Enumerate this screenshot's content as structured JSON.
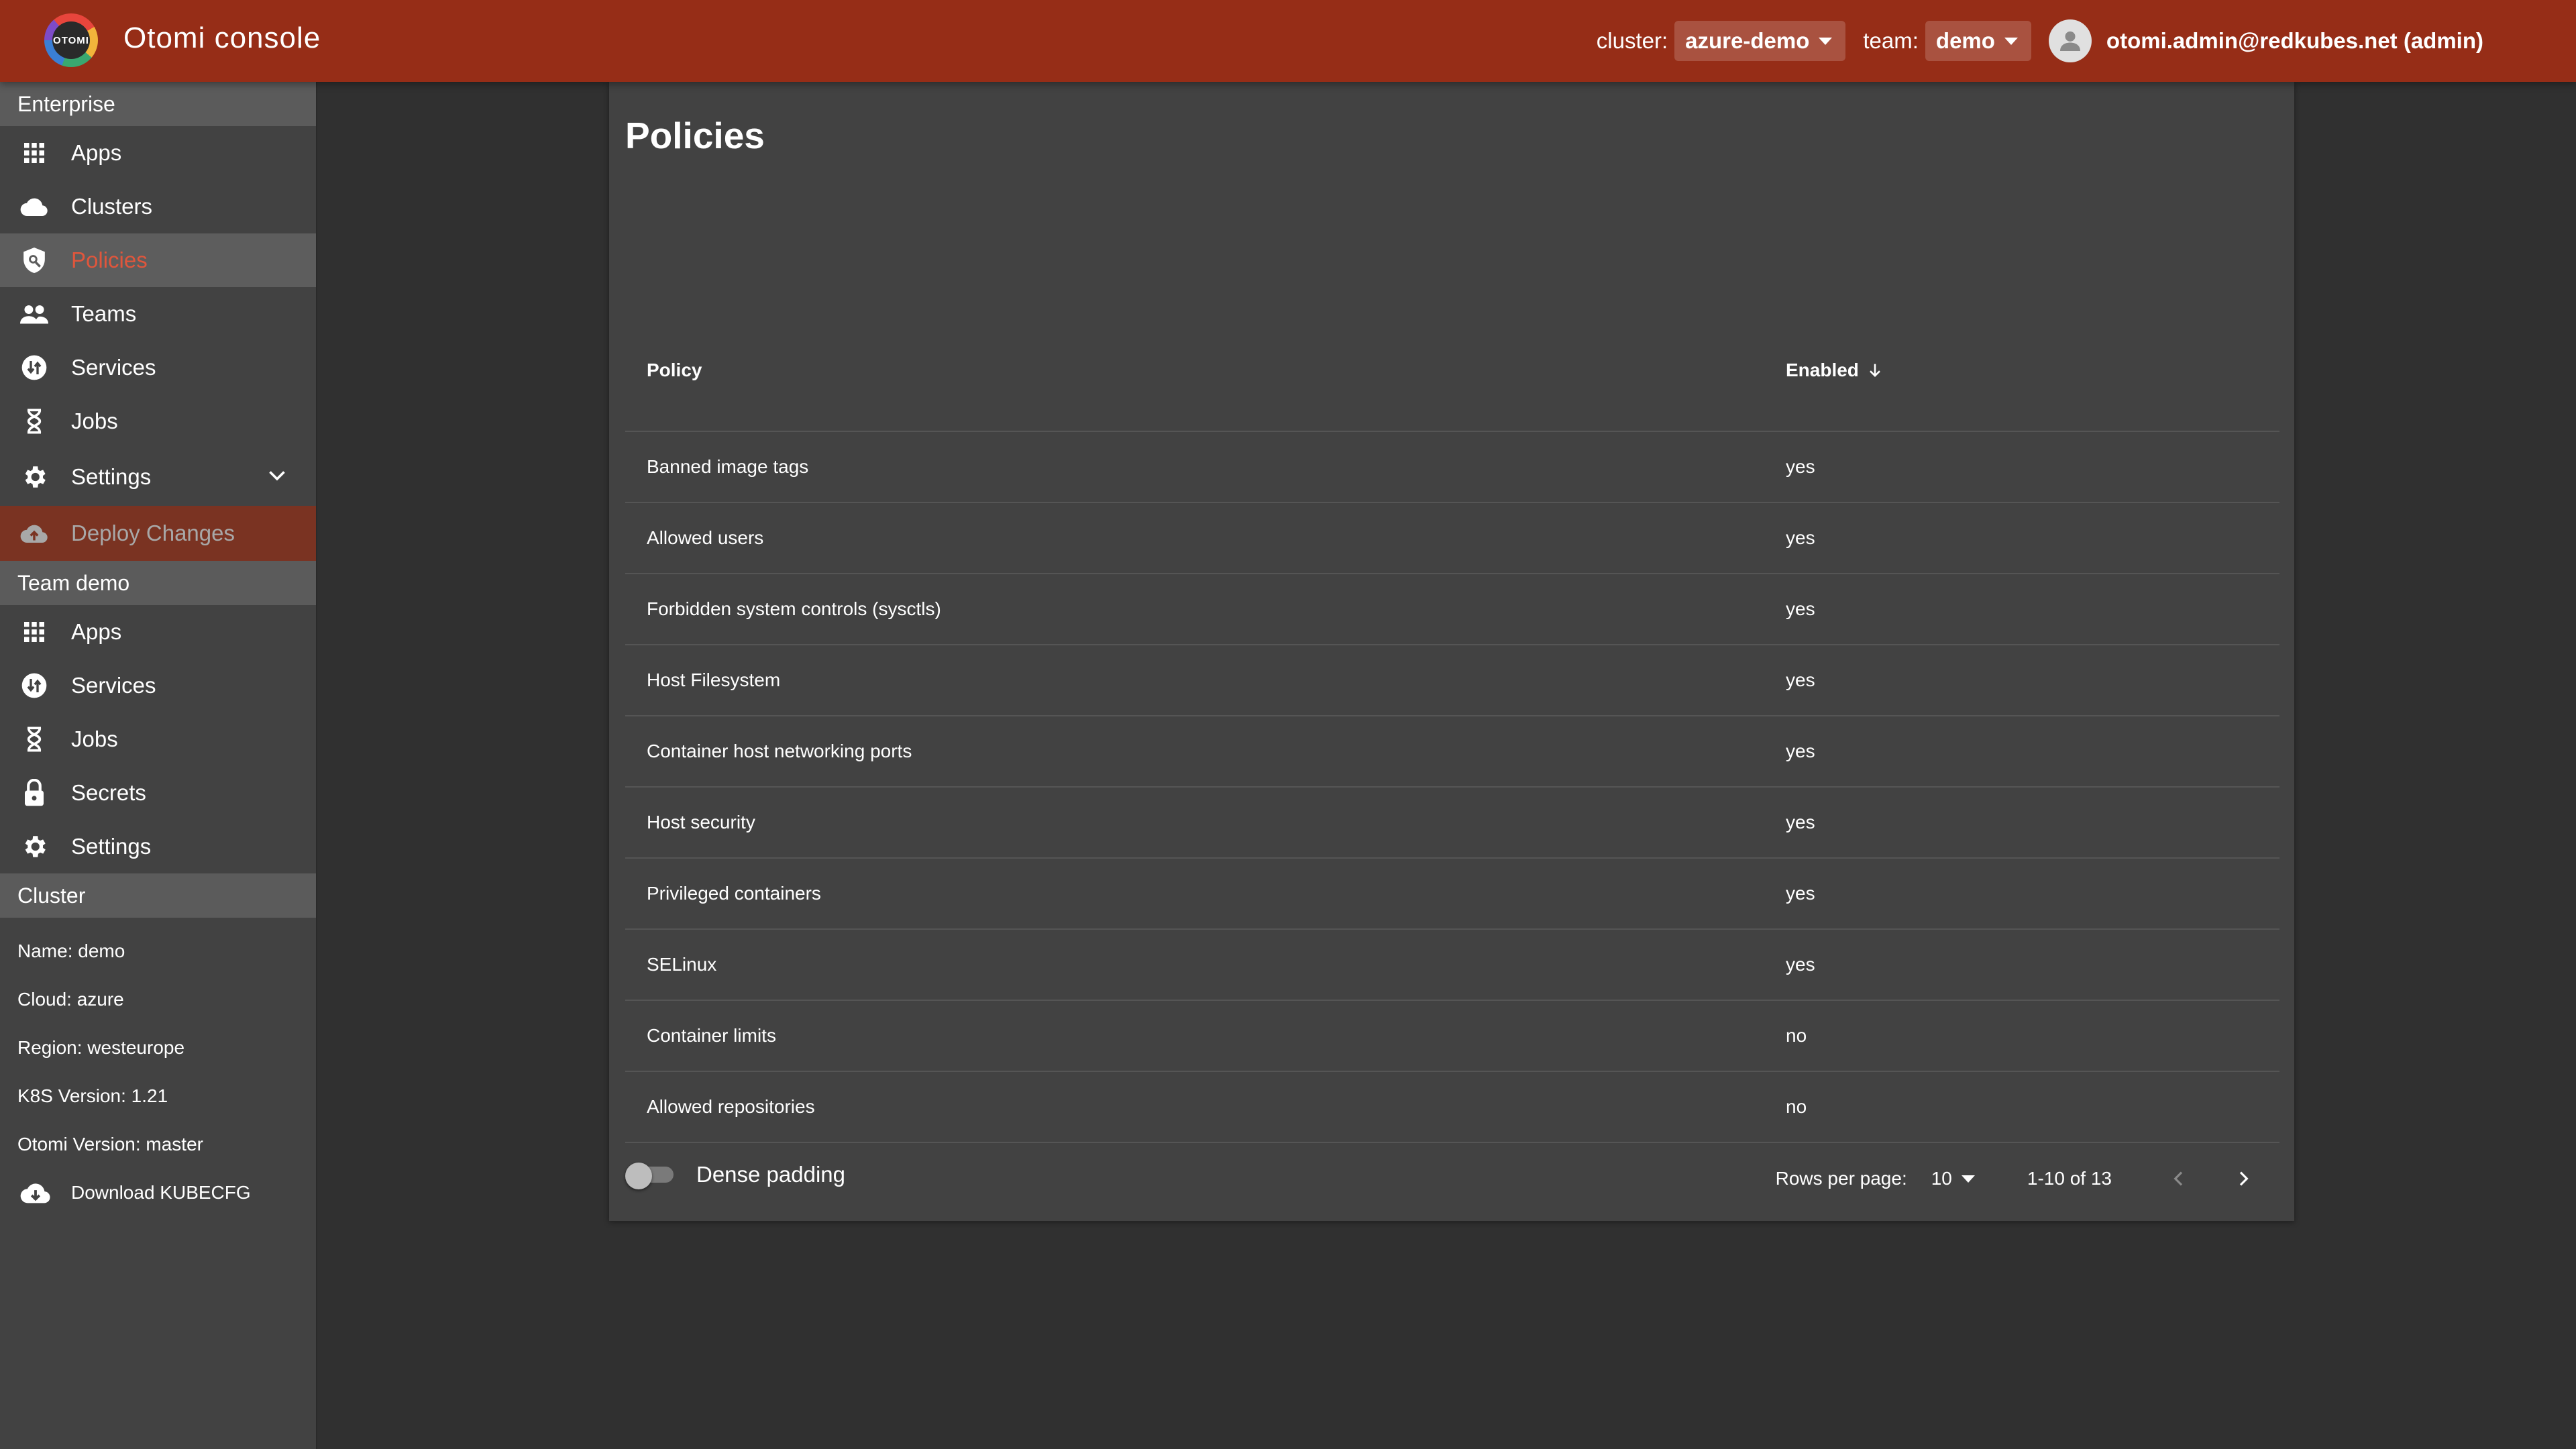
{
  "header": {
    "logo_text": "OTOMI",
    "title": "Otomi console",
    "cluster_label": "cluster:",
    "cluster_value": "azure-demo",
    "team_label": "team:",
    "team_value": "demo",
    "user": "otomi.admin@redkubes.net (admin)"
  },
  "sidebar": {
    "enterprise_header": "Enterprise",
    "enterprise_items": [
      {
        "label": "Apps",
        "icon": "apps-icon"
      },
      {
        "label": "Clusters",
        "icon": "cloud-icon"
      },
      {
        "label": "Policies",
        "icon": "policy-icon",
        "active": true
      },
      {
        "label": "Teams",
        "icon": "people-icon"
      },
      {
        "label": "Services",
        "icon": "swap-icon"
      },
      {
        "label": "Jobs",
        "icon": "hourglass-icon"
      },
      {
        "label": "Settings",
        "icon": "gear-icon"
      }
    ],
    "deploy_label": "Deploy Changes",
    "team_header": "Team demo",
    "team_items": [
      {
        "label": "Apps",
        "icon": "apps-icon"
      },
      {
        "label": "Services",
        "icon": "swap-icon"
      },
      {
        "label": "Jobs",
        "icon": "hourglass-icon"
      },
      {
        "label": "Secrets",
        "icon": "lock-icon"
      },
      {
        "label": "Settings",
        "icon": "gear-icon"
      }
    ],
    "cluster_header": "Cluster",
    "cluster_info": [
      "Name: demo",
      "Cloud: azure",
      "Region: westeurope",
      "K8S Version: 1.21",
      "Otomi Version: master"
    ],
    "download_label": "Download KUBECFG"
  },
  "main": {
    "title": "Policies",
    "columns": {
      "policy": "Policy",
      "enabled": "Enabled"
    },
    "rows": [
      {
        "policy": "Banned image tags",
        "enabled": "yes"
      },
      {
        "policy": "Allowed users",
        "enabled": "yes"
      },
      {
        "policy": "Forbidden system controls (sysctls)",
        "enabled": "yes"
      },
      {
        "policy": "Host Filesystem",
        "enabled": "yes"
      },
      {
        "policy": "Container host networking ports",
        "enabled": "yes"
      },
      {
        "policy": "Host security",
        "enabled": "yes"
      },
      {
        "policy": "Privileged containers",
        "enabled": "yes"
      },
      {
        "policy": "SELinux",
        "enabled": "yes"
      },
      {
        "policy": "Container limits",
        "enabled": "no"
      },
      {
        "policy": "Allowed repositories",
        "enabled": "no"
      }
    ],
    "pagination": {
      "rows_per_page_label": "Rows per page:",
      "rows_per_page": "10",
      "range": "1-10 of 13"
    },
    "dense_padding_label": "Dense padding"
  },
  "colors": {
    "topbar": "#962d17",
    "accent": "#e0563c",
    "background": "#303030",
    "panel": "#424242"
  }
}
